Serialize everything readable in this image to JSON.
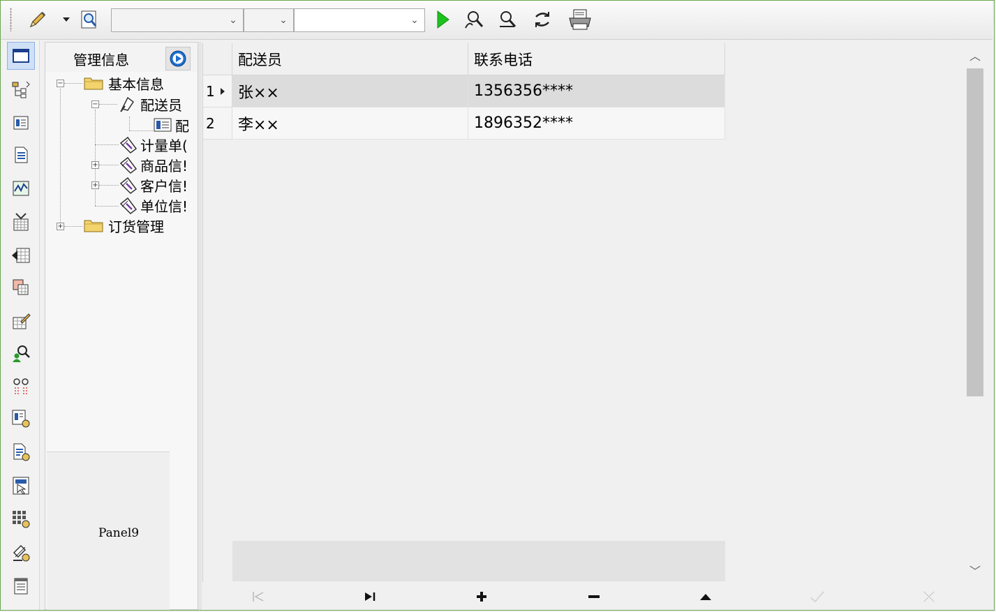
{
  "toolbar": {
    "edit_icon": "pencil-icon",
    "dropdown_icon": "caret-down-icon",
    "query_icon": "magnifier-document-icon",
    "combo1_value": "",
    "combo2_value": "",
    "combo3_value": "",
    "run_icon": "play-icon",
    "find_icon": "find-user-icon",
    "find_next_icon": "find-next-icon",
    "refresh_icon": "refresh-icon",
    "print_icon": "printer-icon"
  },
  "tree": {
    "title": "管理信息",
    "nodes": [
      {
        "label": "基本信息",
        "icon": "folder-icon",
        "expander": "−"
      },
      {
        "label": "配送员",
        "icon": "tool-icon",
        "expander": "−"
      },
      {
        "label": "配",
        "icon": "form-icon"
      },
      {
        "label": "计量单(",
        "icon": "wrench-icon"
      },
      {
        "label": "商品信!",
        "icon": "wrench-icon",
        "expander": "+"
      },
      {
        "label": "客户信!",
        "icon": "wrench-icon",
        "expander": "+"
      },
      {
        "label": "单位信!",
        "icon": "wrench-icon"
      },
      {
        "label": "订货管理",
        "icon": "folder-icon",
        "expander": "+"
      }
    ]
  },
  "panel9": {
    "label": "Panel9"
  },
  "grid": {
    "columns": [
      "配送员",
      "联系电话"
    ],
    "rows": [
      {
        "num": "1",
        "current": true,
        "name": "张××",
        "phone": "1356356****"
      },
      {
        "num": "2",
        "current": false,
        "name": "李××",
        "phone": "1896352****"
      }
    ]
  },
  "navigator": {
    "buttons": [
      "first",
      "last",
      "insert",
      "delete",
      "edit",
      "post",
      "cancel"
    ]
  },
  "colors": {
    "accent": "#1f6fd1",
    "run": "#1ec21e",
    "selected_row": "#dcdcdc",
    "frame": "#6aa84f"
  }
}
